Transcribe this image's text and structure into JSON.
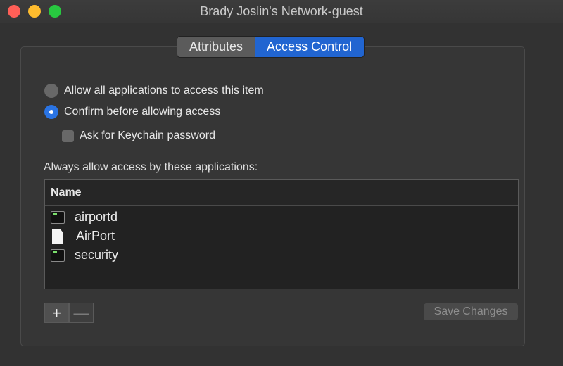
{
  "window": {
    "title": "Brady Joslin's Network-guest"
  },
  "tabs": [
    {
      "label": "Attributes",
      "selected": false
    },
    {
      "label": "Access Control",
      "selected": true
    }
  ],
  "access": {
    "allow_all_label": "Allow all applications to access this item",
    "confirm_label": "Confirm before allowing access",
    "keychain_password_label": "Ask for Keychain password",
    "selected_option": "confirm",
    "keychain_password_checked": false
  },
  "apps": {
    "section_label": "Always allow access by these applications:",
    "column_header": "Name",
    "items": [
      {
        "name": "airportd",
        "icon": "terminal-icon"
      },
      {
        "name": "AirPort",
        "icon": "document-icon"
      },
      {
        "name": "security",
        "icon": "terminal-icon"
      }
    ]
  },
  "buttons": {
    "add": "+",
    "remove": "—",
    "save": "Save Changes"
  },
  "colors": {
    "accent": "#2165d1",
    "close": "#ff5f57",
    "minimize": "#febc2e",
    "maximize": "#28c840"
  }
}
